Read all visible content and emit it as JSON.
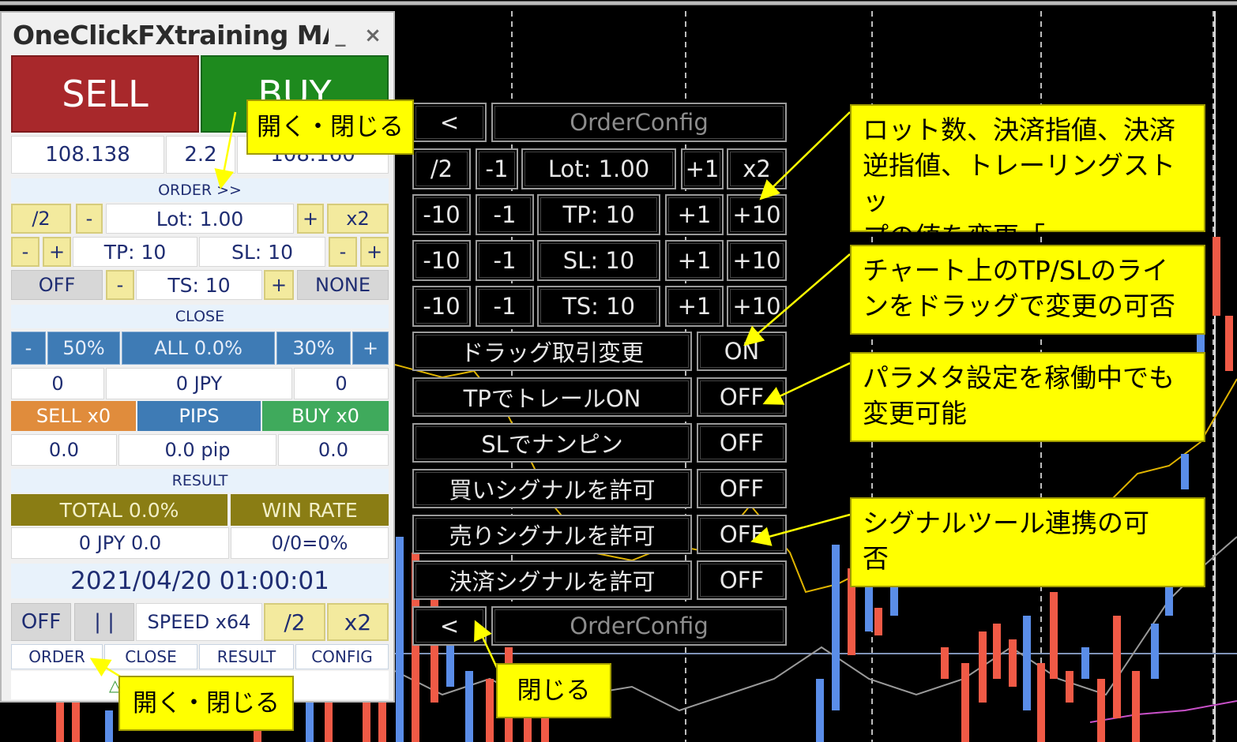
{
  "window": {
    "title": "OneClickFXtraining MA",
    "minimize_label": "_",
    "close_label": "×"
  },
  "trade": {
    "sell_label": "SELL",
    "buy_label": "BUY",
    "bid": "108.138",
    "spread": "2.2",
    "ask": "108.160"
  },
  "order": {
    "header": "ORDER >>",
    "half": "/2",
    "minus": "-",
    "lot": "Lot: 1.00",
    "plus": "+",
    "double": "x2",
    "tp_minus": "-",
    "tp_plus": "+",
    "tp": "TP: 10",
    "sl": "SL: 10",
    "sl_minus": "-",
    "sl_plus": "+",
    "ts_off": "OFF",
    "ts_minus": "-",
    "ts": "TS: 10",
    "ts_plus": "+",
    "ts_mode": "NONE"
  },
  "close": {
    "header": "CLOSE",
    "minus": "-",
    "pct50": "50%",
    "all": "ALL 0.0%",
    "pct30": "30%",
    "plus": "+",
    "sell_count": "0",
    "jpy": "0 JPY",
    "buy_count": "0",
    "sell_btn": "SELL x0",
    "pips_btn": "PIPS",
    "buy_btn": "BUY x0",
    "sell_pips": "0.0",
    "pip": "0.0 pip",
    "buy_pips": "0.0"
  },
  "result": {
    "header": "RESULT",
    "total": "TOTAL 0.0%",
    "winrate_label": "WIN RATE",
    "profit": "0 JPY 0.0",
    "winrate": "0/0=0%",
    "datetime": "2021/04/20  01:00:01"
  },
  "speed": {
    "off": "OFF",
    "pause": "| |",
    "speed": "SPEED x64",
    "half": "/2",
    "double": "x2"
  },
  "tabs": [
    "ORDER",
    "CLOSE",
    "RESULT",
    "CONFIG"
  ],
  "footer_glyph": "△",
  "config": {
    "back": "<",
    "title": "OrderConfig",
    "lot_row": [
      "/2",
      "-1",
      "Lot: 1.00",
      "+1",
      "x2"
    ],
    "tp_row": [
      "-10",
      "-1",
      "TP: 10",
      "+1",
      "+10"
    ],
    "sl_row": [
      "-10",
      "-1",
      "SL: 10",
      "+1",
      "+10"
    ],
    "ts_row": [
      "-10",
      "-1",
      "TS: 10",
      "+1",
      "+10"
    ],
    "toggles": [
      {
        "label": "ドラッグ取引変更",
        "value": "ON"
      },
      {
        "label": "TPでトレールON",
        "value": "OFF"
      },
      {
        "label": "SLでナンピン",
        "value": "OFF"
      },
      {
        "label": "買いシグナルを許可",
        "value": "OFF"
      },
      {
        "label": "売りシグナルを許可",
        "value": "OFF"
      },
      {
        "label": "決済シグナルを許可",
        "value": "OFF"
      }
    ],
    "footer_back": "<",
    "footer_title": "OrderConfig"
  },
  "notes": {
    "open_close_top": "開く・閉じる",
    "open_close_bottom": "開く・閉じる",
    "close_btn": "閉じる",
    "values_line1": "ロット数、決済指値、決済",
    "values_line2": "逆指値、トレーリングストッ",
    "values_line3": "プの値を変更「",
    "drag_line1": "チャート上のTP/SLのライ",
    "drag_line2": "ンをドラッグで変更の可否",
    "param_line1": "パラメタ設定を稼働中でも",
    "param_line2": "変更可能",
    "signal_line1": "シグナルツール連携の可",
    "signal_line2": "否"
  },
  "colors": {
    "sell": "#a8282b",
    "buy": "#1e8a1e",
    "bull_candle": "#5a8de8",
    "bear_candle": "#f05a46",
    "callout": "#ffff00"
  }
}
